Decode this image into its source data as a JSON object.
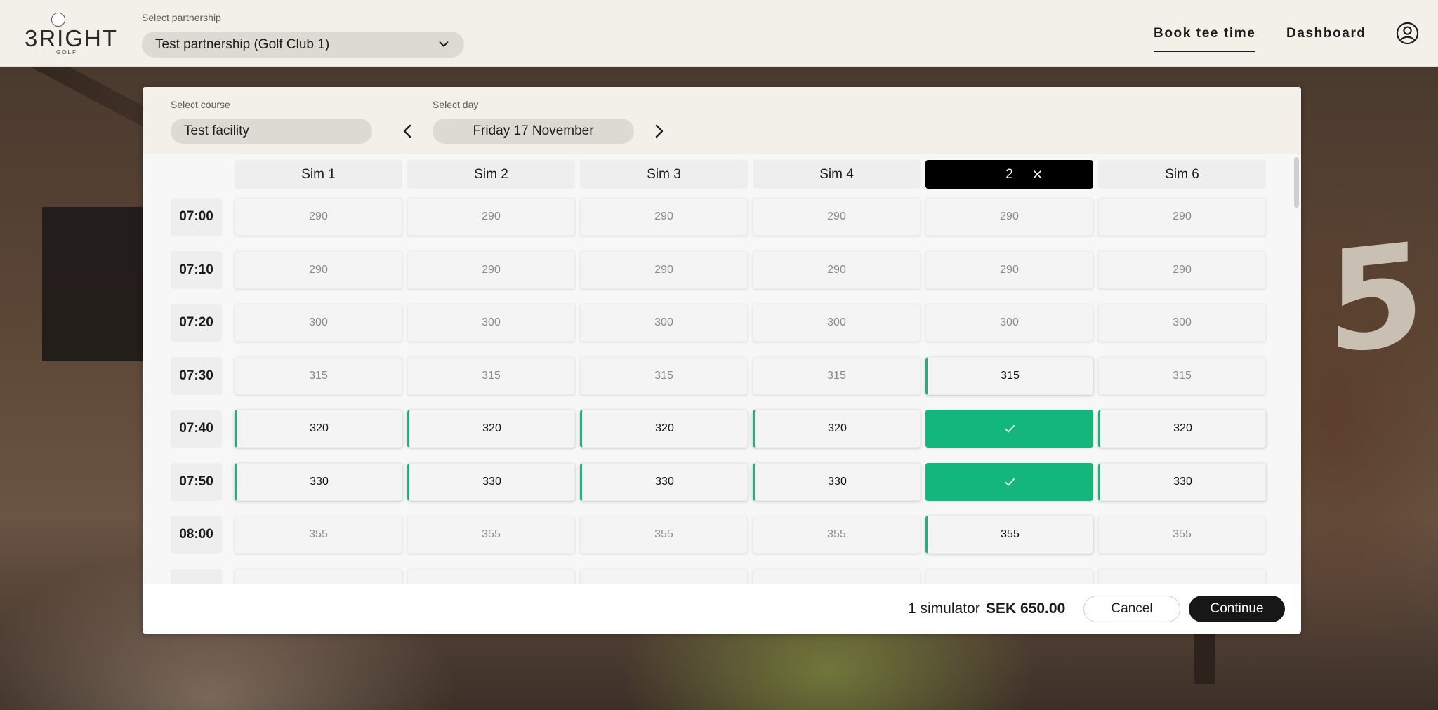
{
  "brand": {
    "logo_word": "3RIGHT",
    "logo_sub": "GOLF"
  },
  "header": {
    "partnership_label": "Select partnership",
    "partnership_value": "Test partnership (Golf Club 1)",
    "nav": {
      "book": "Book tee time",
      "dashboard": "Dashboard"
    },
    "icons": {
      "dropdown": "chevron-down-icon",
      "account": "user-circle-icon"
    }
  },
  "booking": {
    "course_label": "Select course",
    "course_value": "Test facility",
    "day_label": "Select day",
    "day_value": "Friday 17 November",
    "columns": [
      {
        "label": "Sim 1",
        "active": false
      },
      {
        "label": "Sim 2",
        "active": false
      },
      {
        "label": "Sim 3",
        "active": false
      },
      {
        "label": "Sim 4",
        "active": false
      },
      {
        "label": "2",
        "active": true
      },
      {
        "label": "Sim 6",
        "active": false
      }
    ],
    "rows": [
      {
        "time": "07:00",
        "slots": [
          {
            "price": "290",
            "state": "unavailable"
          },
          {
            "price": "290",
            "state": "unavailable"
          },
          {
            "price": "290",
            "state": "unavailable"
          },
          {
            "price": "290",
            "state": "unavailable"
          },
          {
            "price": "290",
            "state": "unavailable"
          },
          {
            "price": "290",
            "state": "unavailable"
          }
        ]
      },
      {
        "time": "07:10",
        "slots": [
          {
            "price": "290",
            "state": "unavailable"
          },
          {
            "price": "290",
            "state": "unavailable"
          },
          {
            "price": "290",
            "state": "unavailable"
          },
          {
            "price": "290",
            "state": "unavailable"
          },
          {
            "price": "290",
            "state": "unavailable"
          },
          {
            "price": "290",
            "state": "unavailable"
          }
        ]
      },
      {
        "time": "07:20",
        "slots": [
          {
            "price": "300",
            "state": "unavailable"
          },
          {
            "price": "300",
            "state": "unavailable"
          },
          {
            "price": "300",
            "state": "unavailable"
          },
          {
            "price": "300",
            "state": "unavailable"
          },
          {
            "price": "300",
            "state": "unavailable"
          },
          {
            "price": "300",
            "state": "unavailable"
          }
        ]
      },
      {
        "time": "07:30",
        "slots": [
          {
            "price": "315",
            "state": "unavailable"
          },
          {
            "price": "315",
            "state": "unavailable"
          },
          {
            "price": "315",
            "state": "unavailable"
          },
          {
            "price": "315",
            "state": "unavailable"
          },
          {
            "price": "315",
            "state": "available"
          },
          {
            "price": "315",
            "state": "unavailable"
          }
        ]
      },
      {
        "time": "07:40",
        "slots": [
          {
            "price": "320",
            "state": "available"
          },
          {
            "price": "320",
            "state": "available"
          },
          {
            "price": "320",
            "state": "available"
          },
          {
            "price": "320",
            "state": "available"
          },
          {
            "price": "",
            "state": "selected"
          },
          {
            "price": "320",
            "state": "available"
          }
        ]
      },
      {
        "time": "07:50",
        "slots": [
          {
            "price": "330",
            "state": "available"
          },
          {
            "price": "330",
            "state": "available"
          },
          {
            "price": "330",
            "state": "available"
          },
          {
            "price": "330",
            "state": "available"
          },
          {
            "price": "",
            "state": "selected"
          },
          {
            "price": "330",
            "state": "available"
          }
        ]
      },
      {
        "time": "08:00",
        "slots": [
          {
            "price": "355",
            "state": "unavailable"
          },
          {
            "price": "355",
            "state": "unavailable"
          },
          {
            "price": "355",
            "state": "unavailable"
          },
          {
            "price": "355",
            "state": "unavailable"
          },
          {
            "price": "355",
            "state": "available"
          },
          {
            "price": "355",
            "state": "unavailable"
          }
        ]
      },
      {
        "time": "",
        "slots": [
          {
            "price": "",
            "state": "unavailable"
          },
          {
            "price": "",
            "state": "unavailable"
          },
          {
            "price": "",
            "state": "unavailable"
          },
          {
            "price": "",
            "state": "unavailable"
          },
          {
            "price": "",
            "state": "unavailable"
          },
          {
            "price": "",
            "state": "unavailable"
          }
        ]
      }
    ],
    "icons": {
      "prev": "chevron-left-icon",
      "next": "chevron-right-icon",
      "deselect": "close-icon",
      "selected": "check-icon"
    }
  },
  "footer": {
    "count_text": "1 simulator",
    "price_text": "SEK 650.00",
    "cancel_label": "Cancel",
    "continue_label": "Continue"
  },
  "colors": {
    "header_bg": "#f3f0ea",
    "pill_bg": "#dcdad3",
    "accent_green": "#13b67b",
    "active_header": "#000000",
    "primary_button": "#171717"
  }
}
